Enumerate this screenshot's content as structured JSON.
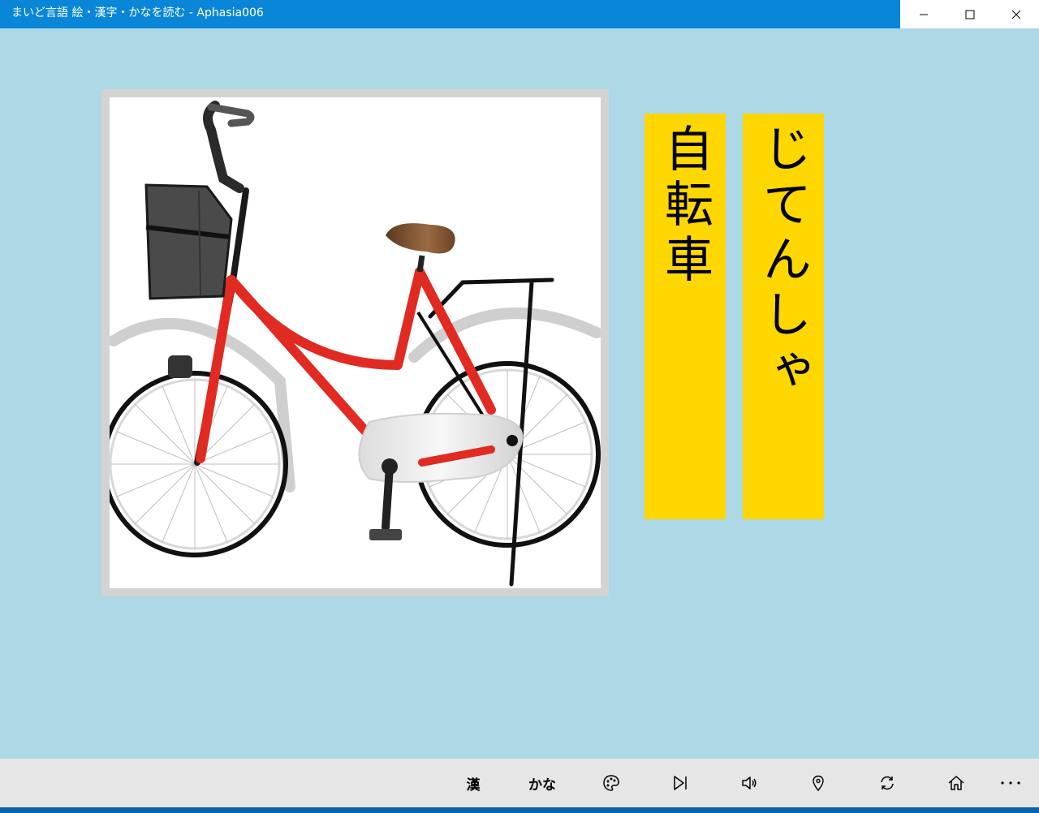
{
  "window": {
    "title": "まいど言語 絵・漢字・かなを読む - Aphasia006",
    "title_bar_color": "#0A86D8",
    "controls": [
      "minimize-icon",
      "maximize-icon",
      "close-icon"
    ]
  },
  "content": {
    "background_color": "#ADD8E6",
    "picture": {
      "subject_icon": "bicycle-illustration",
      "frame_color": "#D3D3D3"
    },
    "kanji_card": {
      "text": "自転車",
      "color": "#FFD700"
    },
    "kana_card": {
      "text": "じてんしゃ",
      "color": "#FFD700"
    }
  },
  "appbar": {
    "buttons": [
      {
        "id": "kanji",
        "label": "漢"
      },
      {
        "id": "kana",
        "label": "かな"
      },
      {
        "id": "color",
        "icon": "palette-icon"
      },
      {
        "id": "next",
        "icon": "skip-next-icon"
      },
      {
        "id": "sound",
        "icon": "speaker-icon"
      },
      {
        "id": "hint",
        "icon": "location-pin-icon"
      },
      {
        "id": "refresh",
        "icon": "refresh-icon"
      },
      {
        "id": "home",
        "icon": "home-icon"
      },
      {
        "id": "more",
        "icon": "more-icon"
      }
    ]
  }
}
